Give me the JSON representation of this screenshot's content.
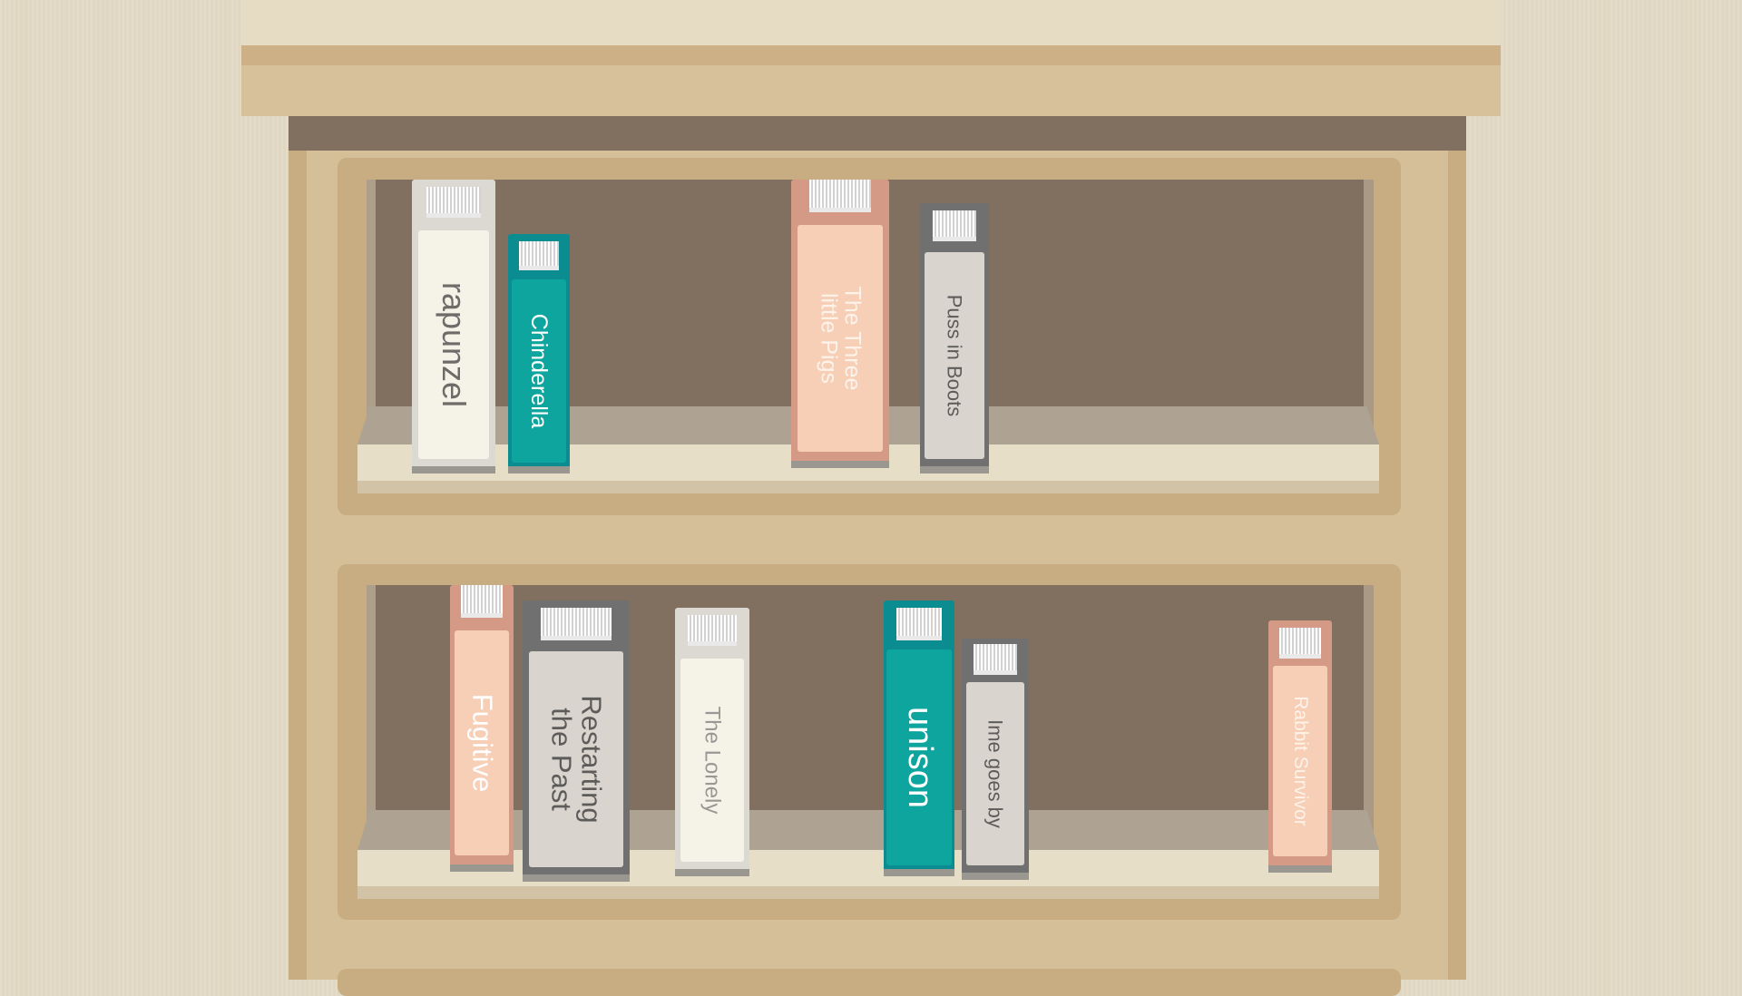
{
  "colors": {
    "wall": "#e3dac5",
    "wood_light": "#d5bf99",
    "wood_dark": "#c9ad82",
    "shelf_back": "#817060",
    "ledge": "#e6dec7"
  },
  "shelves": [
    {
      "books": [
        {
          "title": "rapunzel",
          "color_name": "cream"
        },
        {
          "title": "Chinderella",
          "color_name": "teal"
        },
        {
          "title": "The Three little Pigs",
          "lines": [
            "The Three",
            "little Pigs"
          ],
          "color_name": "peach"
        },
        {
          "title": "Puss in Boots",
          "color_name": "gray"
        }
      ]
    },
    {
      "books": [
        {
          "title": "Fugitive",
          "color_name": "peach"
        },
        {
          "title": "Restarting the Past",
          "lines": [
            "Restarting",
            "the Past"
          ],
          "color_name": "gray"
        },
        {
          "title": "The Lonely",
          "color_name": "cream"
        },
        {
          "title": "unison",
          "color_name": "teal"
        },
        {
          "title": "Ime goes by",
          "color_name": "gray"
        },
        {
          "title": "Rabbit Survivor",
          "color_name": "peach"
        }
      ]
    }
  ]
}
